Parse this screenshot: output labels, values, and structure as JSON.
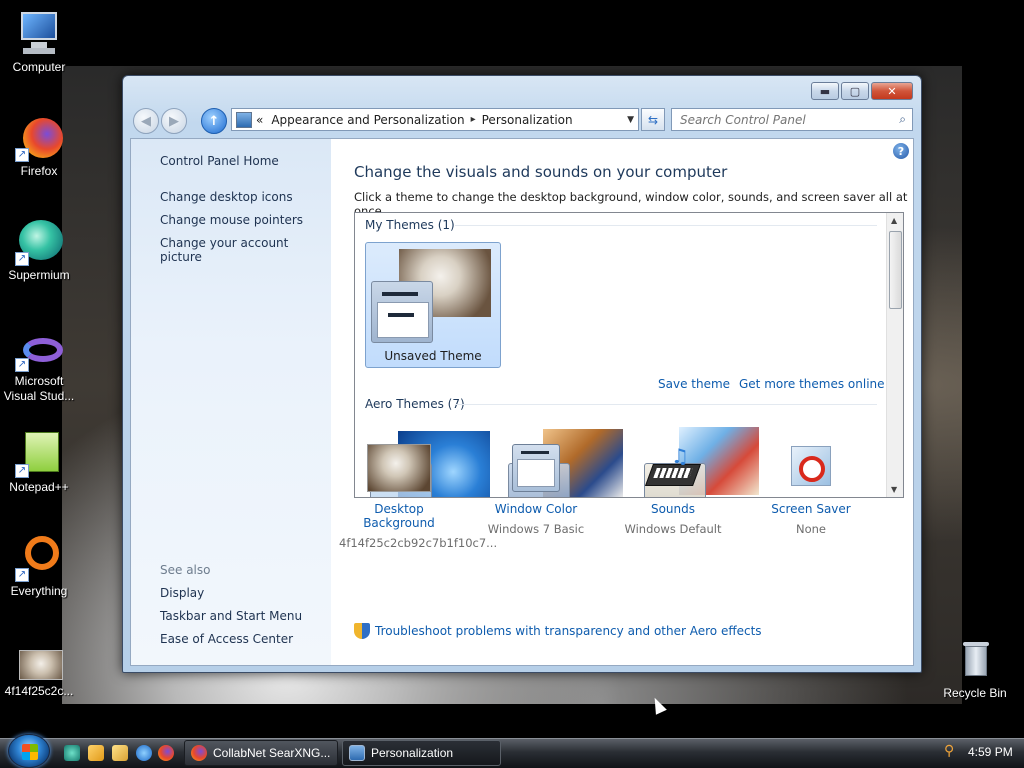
{
  "desktop": {
    "icons": [
      {
        "label": "Computer"
      },
      {
        "label": "Firefox"
      },
      {
        "label": "Supermium"
      },
      {
        "label": "Microsoft Visual Stud..."
      },
      {
        "label": "Notepad++"
      },
      {
        "label": "Everything"
      },
      {
        "label": "4f14f25c2c..."
      },
      {
        "label": "Recycle Bin"
      }
    ]
  },
  "window": {
    "title_buttons": {
      "minimize": "▬",
      "maximize": "▢",
      "close": "✕"
    },
    "address": {
      "chevron": "«",
      "crumbs": [
        "Appearance and Personalization",
        "Personalization"
      ],
      "separator": "▸"
    },
    "search": {
      "placeholder": "Search Control Panel"
    },
    "left_pane": {
      "home": "Control Panel Home",
      "tasks": [
        "Change desktop icons",
        "Change mouse pointers",
        "Change your account picture"
      ],
      "see_also_heading": "See also",
      "see_also": [
        "Display",
        "Taskbar and Start Menu",
        "Ease of Access Center"
      ]
    },
    "main": {
      "heading": "Change the visuals and sounds on your computer",
      "description": "Click a theme to change the desktop background, window color, sounds, and screen saver all at once.",
      "my_themes_title": "My Themes (1)",
      "unsaved_theme": "Unsaved Theme",
      "save_theme": "Save theme",
      "get_more": "Get more themes online",
      "aero_themes_title": "Aero Themes (7)"
    },
    "settings": [
      {
        "name": "Desktop Background",
        "value": "4f14f25c2cb92c7b1f10c7..."
      },
      {
        "name": "Window Color",
        "value": "Windows 7 Basic"
      },
      {
        "name": "Sounds",
        "value": "Windows Default"
      },
      {
        "name": "Screen Saver",
        "value": "None"
      }
    ],
    "troubleshoot": "Troubleshoot problems with transparency and other Aero effects",
    "help": "?"
  },
  "taskbar": {
    "buttons": [
      {
        "label": "CollabNet SearXNG..."
      },
      {
        "label": "Personalization"
      }
    ],
    "clock": "4:59 PM"
  }
}
